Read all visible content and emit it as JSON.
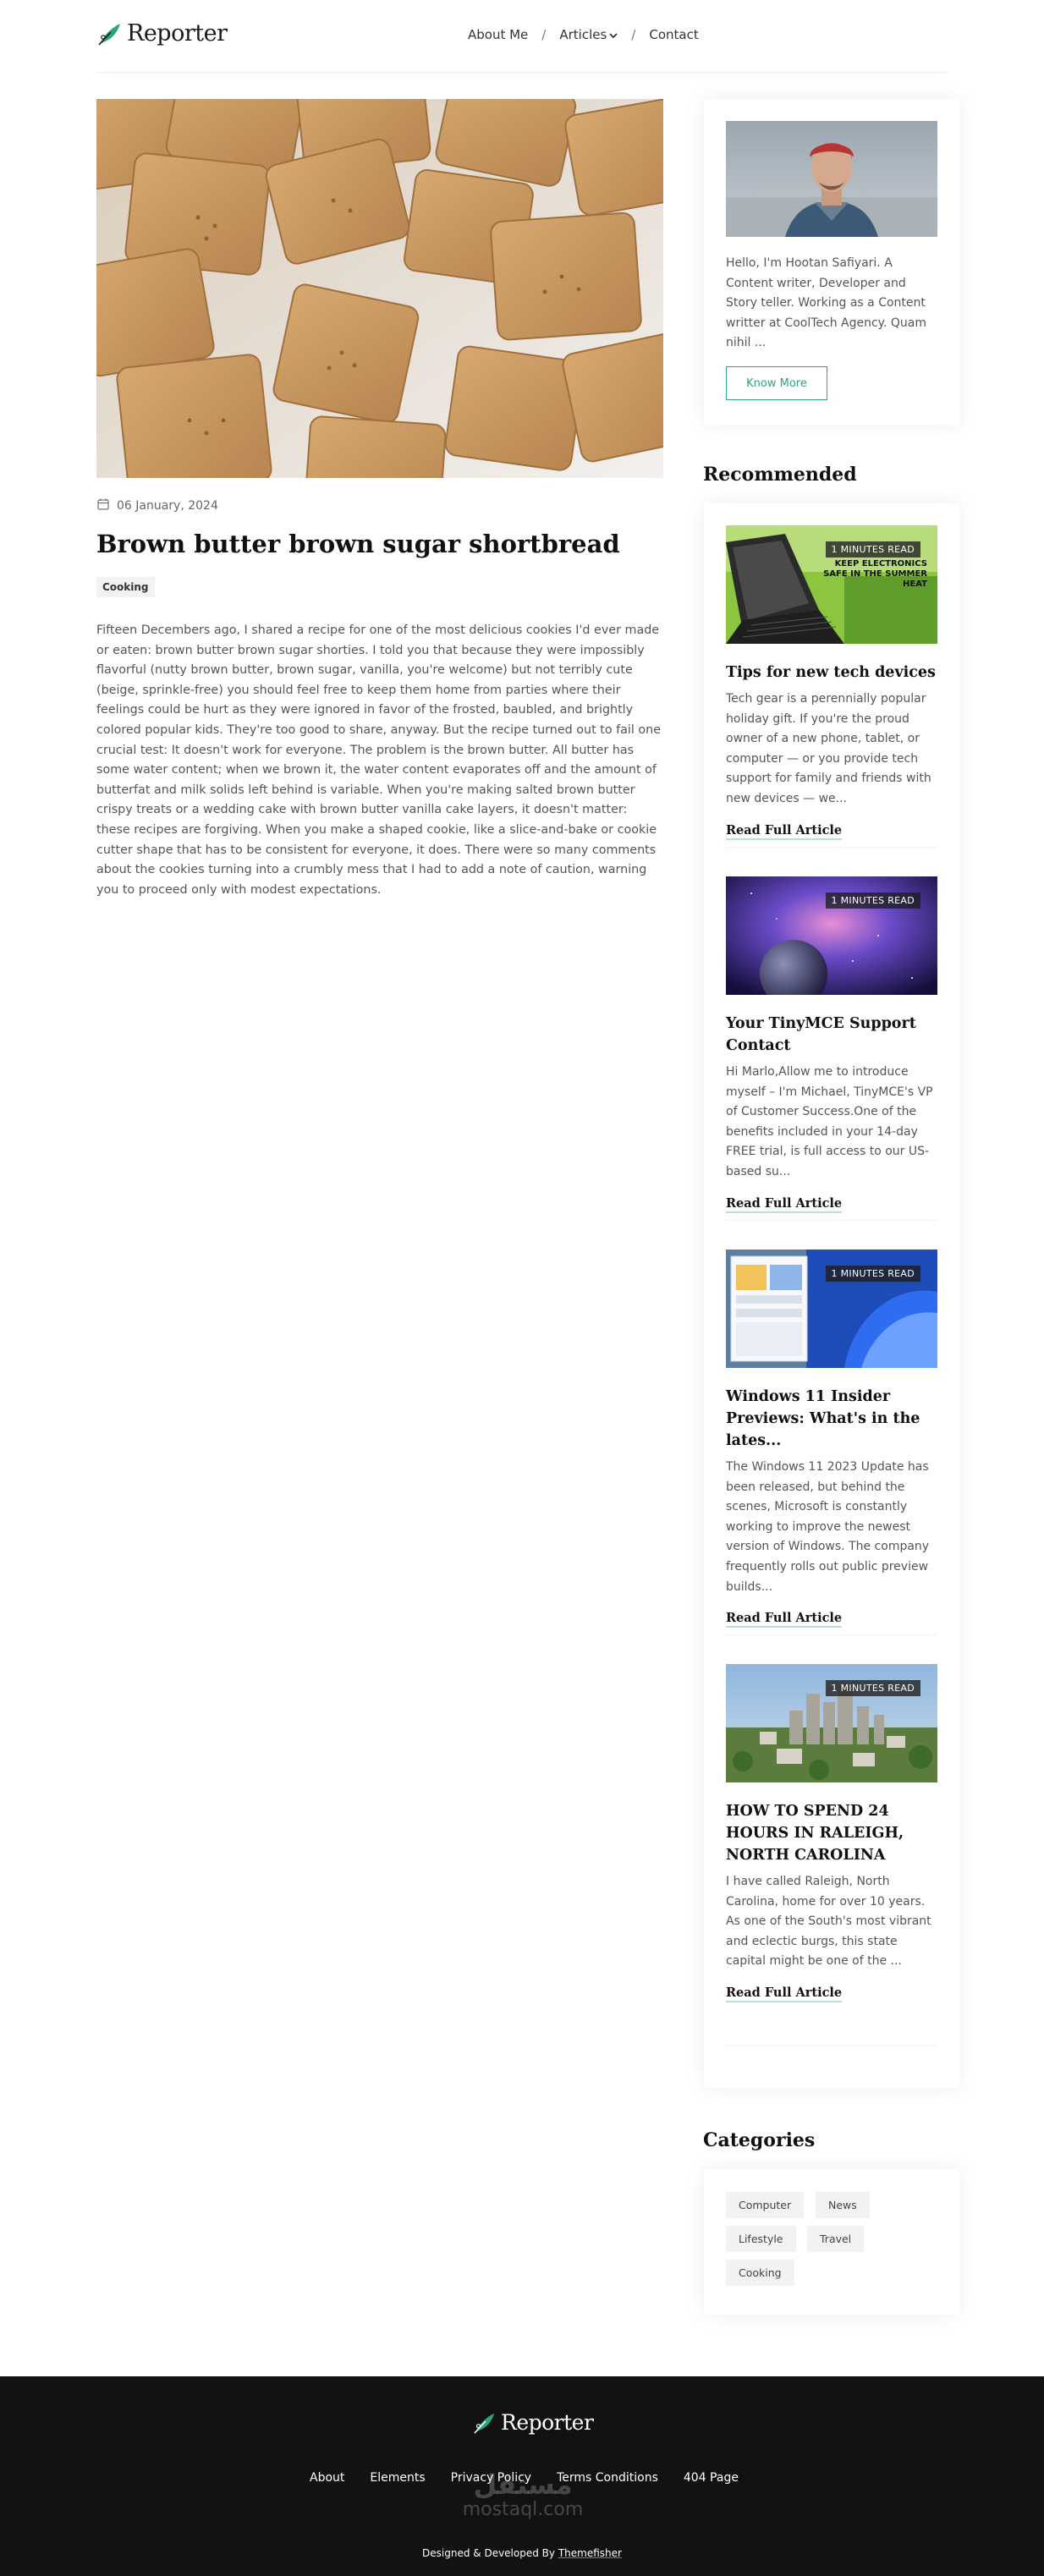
{
  "brand": {
    "name": "Reporter",
    "accent": "#2ea575"
  },
  "nav": {
    "items": [
      "About Me",
      "Articles",
      "Contact"
    ],
    "separator": "/"
  },
  "post": {
    "date": "06 January, 2024",
    "title": "Brown butter brown sugar shortbread",
    "tag": "Cooking",
    "body": "Fifteen Decembers ago, I shared a recipe for one of the most delicious cookies I'd ever made or eaten: brown butter brown sugar shorties. I told you that because they were impossibly flavorful (nutty brown butter, brown sugar, vanilla, you're welcome) but not terribly cute (beige, sprinkle-free) you should feel free to keep them home from parties where their feelings could be hurt as they were ignored in favor of the frosted, baubled, and brightly colored popular kids. They're too good to share, anyway. But the recipe turned out to fail one crucial test: It doesn't work for everyone. The problem is the brown butter. All butter has some water content; when we brown it, the water content evaporates off and the amount of butterfat and milk solids left behind is variable. When you're making salted brown butter crispy treats or a wedding cake with brown butter vanilla cake layers, it doesn't matter: these recipes are forgiving. When you make a shaped cookie, like a slice-and-bake or cookie cutter shape that has to be consistent for everyone, it does. There were so many comments about the cookies turning into a crumbly mess that I had to add a note of caution, warning you to proceed only with modest expectations."
  },
  "author": {
    "bio": "Hello, I'm Hootan Safiyari. A Content writer, Developer and Story teller. Working as a Content writter at CoolTech Agency. Quam nihil ...",
    "button": "Know More"
  },
  "recommended": {
    "heading": "Recommended",
    "items": [
      {
        "badge": "1 MINUTES READ",
        "title": "Tips for new tech devices",
        "excerpt": "Tech gear is a perennially popular holiday gift. If you're the proud owner of a new phone, tablet, or computer — or you provide tech support for family and friends with new devices — we...",
        "link": "Read Full Article",
        "thumb_text": "KEEP ELECTRONICS SAFE IN THE SUMMER HEAT"
      },
      {
        "badge": "1 MINUTES READ",
        "title": "Your TinyMCE Support Contact",
        "excerpt": "Hi Marlo,Allow me to introduce myself – I'm Michael, TinyMCE's VP of Customer Success.One of the benefits included in your 14-day FREE trial, is full access to our US-based su...",
        "link": "Read Full Article"
      },
      {
        "badge": "1 MINUTES READ",
        "title": "Windows 11 Insider Previews: What's in the lates...",
        "excerpt": "The Windows 11 2023 Update has been released, but behind the scenes, Microsoft is constantly working to improve the newest version of Windows. The company frequently rolls out public preview builds...",
        "link": "Read Full Article"
      },
      {
        "badge": "1 MINUTES READ",
        "title": "HOW TO SPEND 24 HOURS IN RALEIGH, NORTH CAROLINA",
        "excerpt": "I have called Raleigh, North Carolina, home for over 10 years. As one of the South's most vibrant and eclectic burgs, this state capital might be one of the ...",
        "link": "Read Full Article"
      }
    ]
  },
  "categories": {
    "heading": "Categories",
    "items": [
      "Computer",
      "News",
      "Lifestyle",
      "Travel",
      "Cooking"
    ]
  },
  "footer": {
    "brand": "Reporter",
    "links": [
      "About",
      "Elements",
      "Privacy Policy",
      "Terms Conditions",
      "404 Page"
    ],
    "credit_prefix": "Designed & Developed By",
    "credit_link": "Themefisher",
    "watermark_line1": "مستقل",
    "watermark_line2": "mostaql.com"
  }
}
